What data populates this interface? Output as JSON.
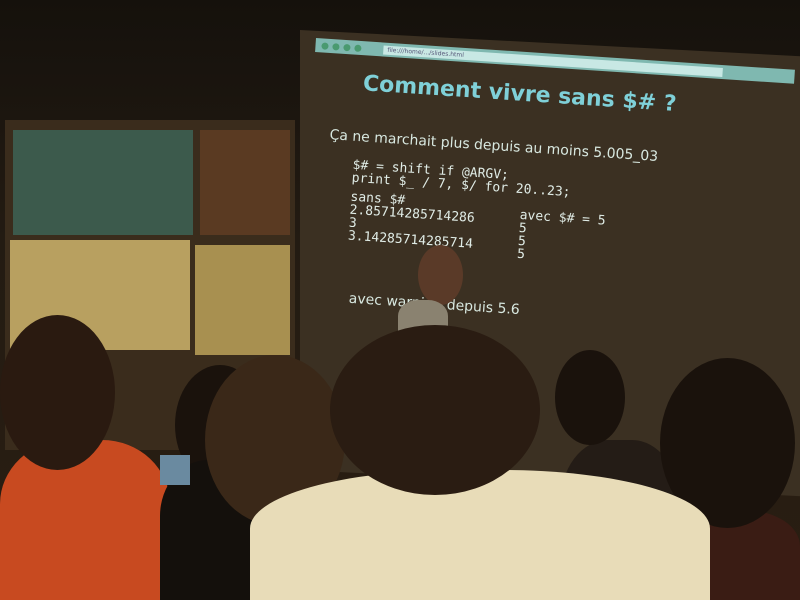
{
  "slide": {
    "browser_url": "file:///home/.../slides.html",
    "title": "Comment vivre sans  $# ?",
    "subtitle": "Ça ne marchait plus depuis au moins 5.005_03",
    "code_lines": [
      "$# = shift if @ARGV;",
      "print $_ / 7, $/ for 20..23;"
    ],
    "col_left_header": "sans $#",
    "col_left_values": [
      "2.85714285714286",
      "3",
      "3.14285714285714"
    ],
    "col_right_header": "avec $# = 5",
    "col_right_values": [
      "5",
      "5",
      "5"
    ],
    "bullet": "avec warning depuis 5.6"
  }
}
